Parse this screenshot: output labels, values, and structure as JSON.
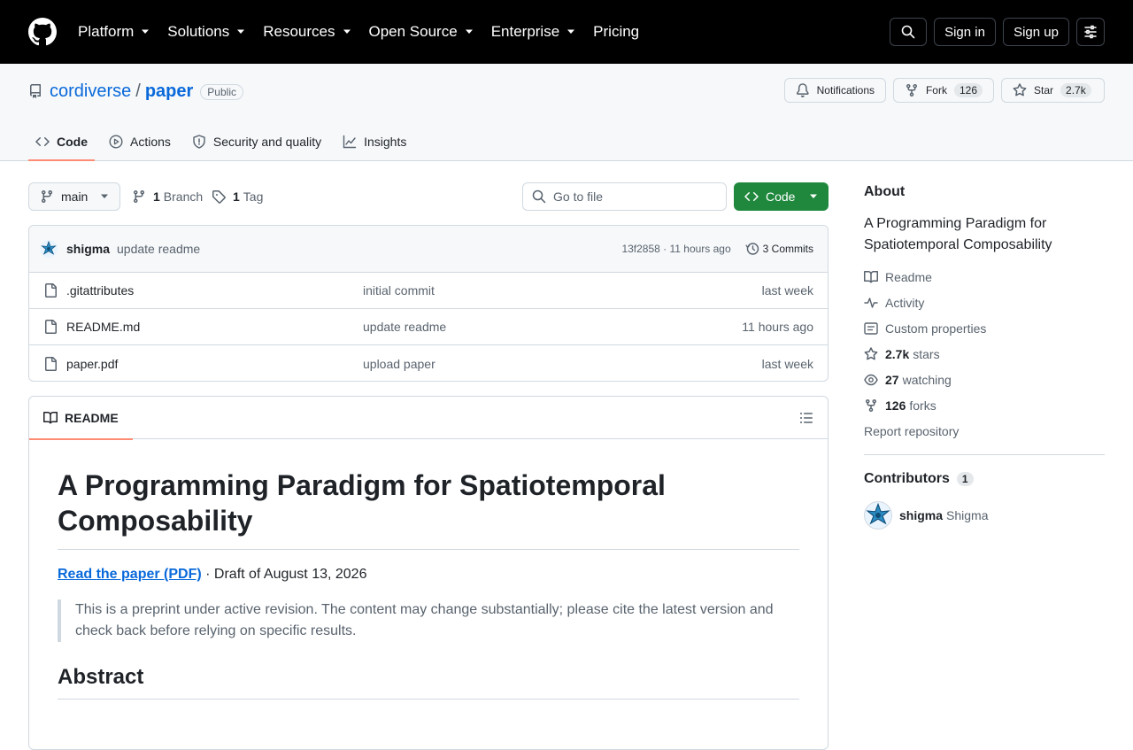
{
  "header": {
    "nav": [
      {
        "label": "Platform"
      },
      {
        "label": "Solutions"
      },
      {
        "label": "Resources"
      },
      {
        "label": "Open Source"
      },
      {
        "label": "Enterprise"
      },
      {
        "label": "Pricing"
      }
    ],
    "sign_in": "Sign in",
    "sign_up": "Sign up"
  },
  "repo": {
    "owner": "cordiverse",
    "separator": "/",
    "name": "paper",
    "visibility": "Public",
    "notifications_label": "Notifications",
    "fork_label": "Fork",
    "fork_count": "126",
    "star_label": "Star",
    "star_count": "2.7k"
  },
  "tabs": [
    {
      "label": "Code",
      "icon": "code-icon"
    },
    {
      "label": "Actions",
      "icon": "play-icon"
    },
    {
      "label": "Security and quality",
      "icon": "shield-icon"
    },
    {
      "label": "Insights",
      "icon": "graph-icon"
    }
  ],
  "toolbar": {
    "branch": "main",
    "branch_count": "1",
    "branch_label": "Branch",
    "tag_count": "1",
    "tag_label": "Tag",
    "goto_placeholder": "Go to file",
    "code_label": "Code"
  },
  "commit": {
    "author": "shigma",
    "message": "update readme",
    "meta": "13f2858 · 11 hours ago",
    "commits_label": "3 Commits"
  },
  "files": [
    {
      "name": ".gitattributes",
      "message": "initial commit",
      "date": "last week"
    },
    {
      "name": "README.md",
      "message": "update readme",
      "date": "11 hours ago"
    },
    {
      "name": "paper.pdf",
      "message": "upload paper",
      "date": "last week"
    }
  ],
  "readme": {
    "tab_label": "README",
    "title": "A Programming Paradigm for Spatiotemporal Composability",
    "link_text": "Read the paper (PDF)",
    "draft_text": " · Draft of August 13, 2026",
    "quote": "This is a preprint under active revision. The content may change substantially; please cite the latest version and check back before relying on specific results.",
    "abstract_heading": "Abstract"
  },
  "about": {
    "title": "About",
    "description": "A Programming Paradigm for Spatiotemporal Composability",
    "readme": "Readme",
    "activity": "Activity",
    "custom_properties": "Custom properties",
    "stars_count": "2.7k",
    "stars_label": "stars",
    "watching_count": "27",
    "watching_label": "watching",
    "forks_count": "126",
    "forks_label": "forks",
    "report": "Report repository"
  },
  "contributors": {
    "title": "Contributors",
    "count": "1",
    "login": "shigma",
    "name": "Shigma"
  },
  "colors": {
    "header_bg": "#000000",
    "link": "#0969da",
    "primary_button": "#1f883d",
    "tab_underline": "#fd8c73"
  }
}
